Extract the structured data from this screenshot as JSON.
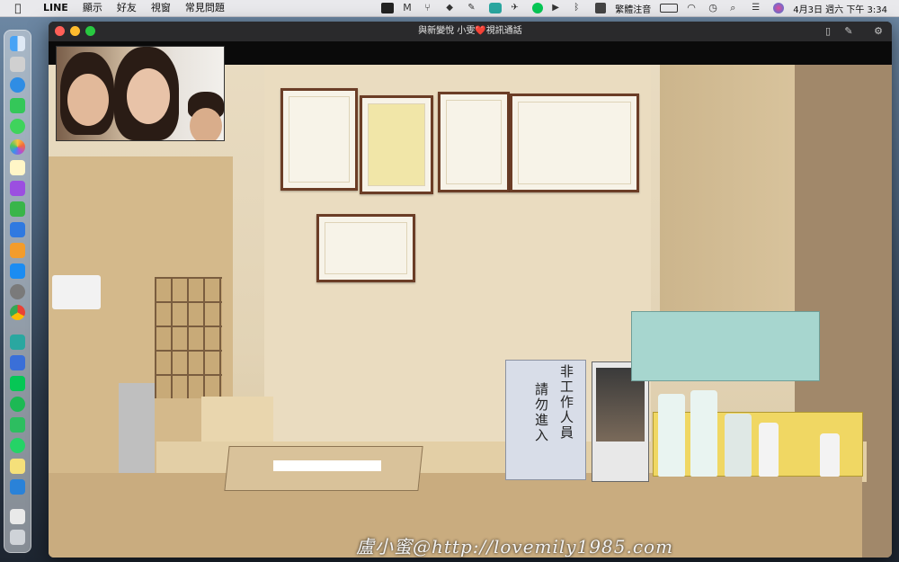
{
  "menubar": {
    "app_name": "LINE",
    "items": [
      "顯示",
      "好友",
      "視窗",
      "常見問題"
    ],
    "input_method": "繁體注音",
    "clock": "4月3日 週六 下午 3:34"
  },
  "window": {
    "title": "與新變悅 小雯❤️視訊通話"
  },
  "scene": {
    "sign_text": [
      "非工作人員",
      "請勿進入"
    ],
    "watermark": "盧小蜜@http://lovemily1985.com"
  },
  "colors": {
    "close": "#ff5f57",
    "minimize": "#febc2e",
    "maximize": "#28c840",
    "line_green": "#06c755"
  },
  "dock_icons": [
    "finder-icon",
    "launchpad-icon",
    "safari-icon",
    "facetime-icon",
    "messages-icon",
    "photos-icon",
    "notes-icon",
    "podcasts-icon",
    "numbers-icon",
    "keynote-icon",
    "pages-icon",
    "app-store-icon",
    "system-preferences-icon",
    "chrome-icon",
    "search-app-icon",
    "network-icon",
    "line-icon",
    "spotify-icon",
    "evernote-icon",
    "whatsapp-icon",
    "stickies-icon",
    "twitter-bird-icon",
    "document-icon"
  ]
}
